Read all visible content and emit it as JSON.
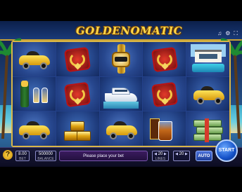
{
  "title": "GOLDENOMATIC",
  "top_icons": [
    "sound-icon",
    "settings-icon",
    "fullscreen-icon"
  ],
  "reels": [
    [
      "car",
      "necklace",
      "watch",
      "necklace",
      "villa"
    ],
    [
      "champagne",
      "necklace",
      "yacht",
      "necklace",
      "car"
    ],
    [
      "car",
      "gold-bars",
      "car",
      "whisky",
      "cash"
    ]
  ],
  "controls": {
    "help_label": "?",
    "bet_value": "8.00",
    "bet_label": "BET",
    "balance_value": "500000",
    "balance_label": "BALANCE",
    "message": "Please place your bet",
    "lines_value": "20",
    "lines_label": "LINES",
    "lines_value2": "20",
    "lines_label2": "",
    "auto_label": "AUTO",
    "start_label": "START"
  },
  "colors": {
    "accent_gold": "#ffd84a",
    "start_blue": "#1552c8",
    "frame_gold": "#d9b648"
  }
}
